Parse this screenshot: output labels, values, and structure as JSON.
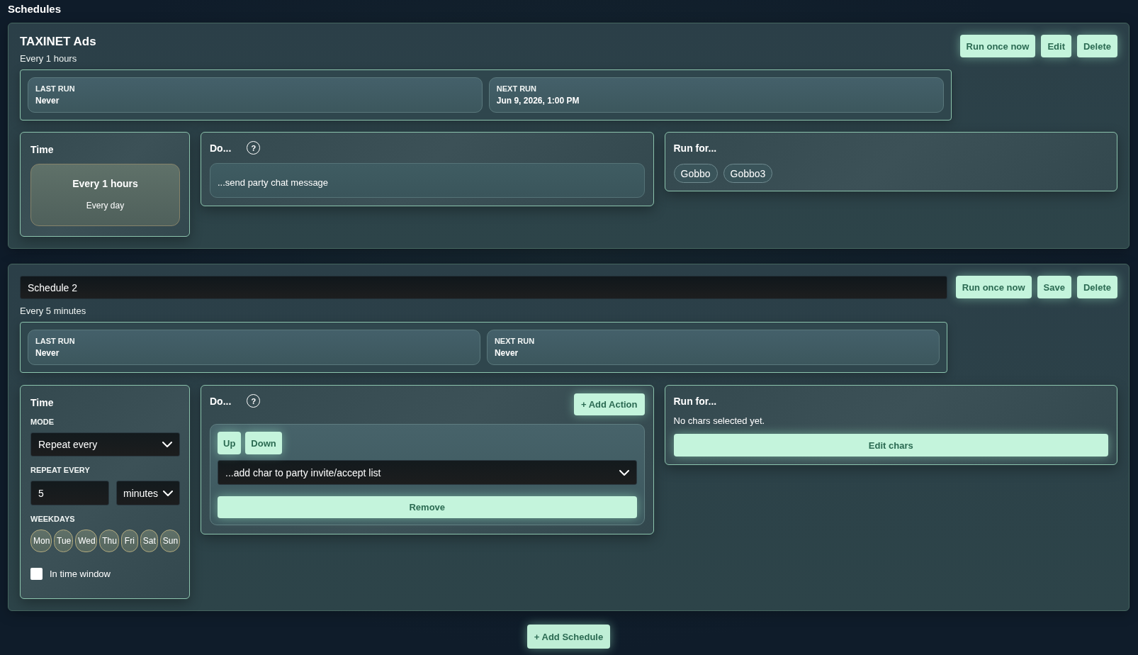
{
  "page_title": "Schedules",
  "schedules": [
    {
      "kind": "view",
      "name": "TAXINET Ads",
      "summary": "Every 1 hours",
      "buttons": {
        "run": "Run once now",
        "edit": "Edit",
        "delete": "Delete"
      },
      "stats": [
        {
          "label": "LAST RUN",
          "value": "Never"
        },
        {
          "label": "NEXT RUN",
          "value": "Jun 9, 2026, 1:00 PM"
        }
      ],
      "time": {
        "kind": "summary",
        "title": "Time",
        "primary": "Every 1 hours",
        "secondary": "Every day"
      },
      "actions": {
        "title": "Do...",
        "help": "?",
        "items": [
          {
            "kind": "text",
            "label": "...send party chat message"
          }
        ]
      },
      "run_for": {
        "title": "Run for...",
        "chars": [
          "Gobbo",
          "Gobbo3"
        ]
      }
    },
    {
      "kind": "edit",
      "name": "Schedule 2",
      "summary": "Every 5 minutes",
      "buttons": {
        "run": "Run once now",
        "save": "Save",
        "delete": "Delete"
      },
      "stats": [
        {
          "label": "LAST RUN",
          "value": "Never"
        },
        {
          "label": "NEXT RUN",
          "value": "Never"
        }
      ],
      "time": {
        "kind": "form",
        "title": "Time",
        "mode_label": "MODE",
        "mode": "Repeat every",
        "repeat_label": "REPEAT EVERY",
        "repeat_value": "5",
        "repeat_unit": "minutes",
        "weekdays_label": "WEEKDAYS",
        "weekdays": [
          {
            "label": "Mon",
            "selected": true
          },
          {
            "label": "Tue",
            "selected": true
          },
          {
            "label": "Wed",
            "selected": true
          },
          {
            "label": "Thu",
            "selected": true
          },
          {
            "label": "Fri",
            "selected": true
          },
          {
            "label": "Sat",
            "selected": true
          },
          {
            "label": "Sun",
            "selected": true
          }
        ],
        "time_window": {
          "label": "In time window",
          "checked": false
        }
      },
      "actions": {
        "title": "Do...",
        "help": "?",
        "add_button": "+ Add Action",
        "items": [
          {
            "kind": "editor",
            "move_buttons": {
              "up": "Up",
              "down": "Down"
            },
            "value": "...add char to party invite/accept list",
            "remove_button": "Remove"
          }
        ]
      },
      "run_for": {
        "title": "Run for...",
        "empty_text": "No chars selected yet.",
        "edit_button": "Edit chars"
      }
    }
  ],
  "add_button": "+ Add Schedule"
}
